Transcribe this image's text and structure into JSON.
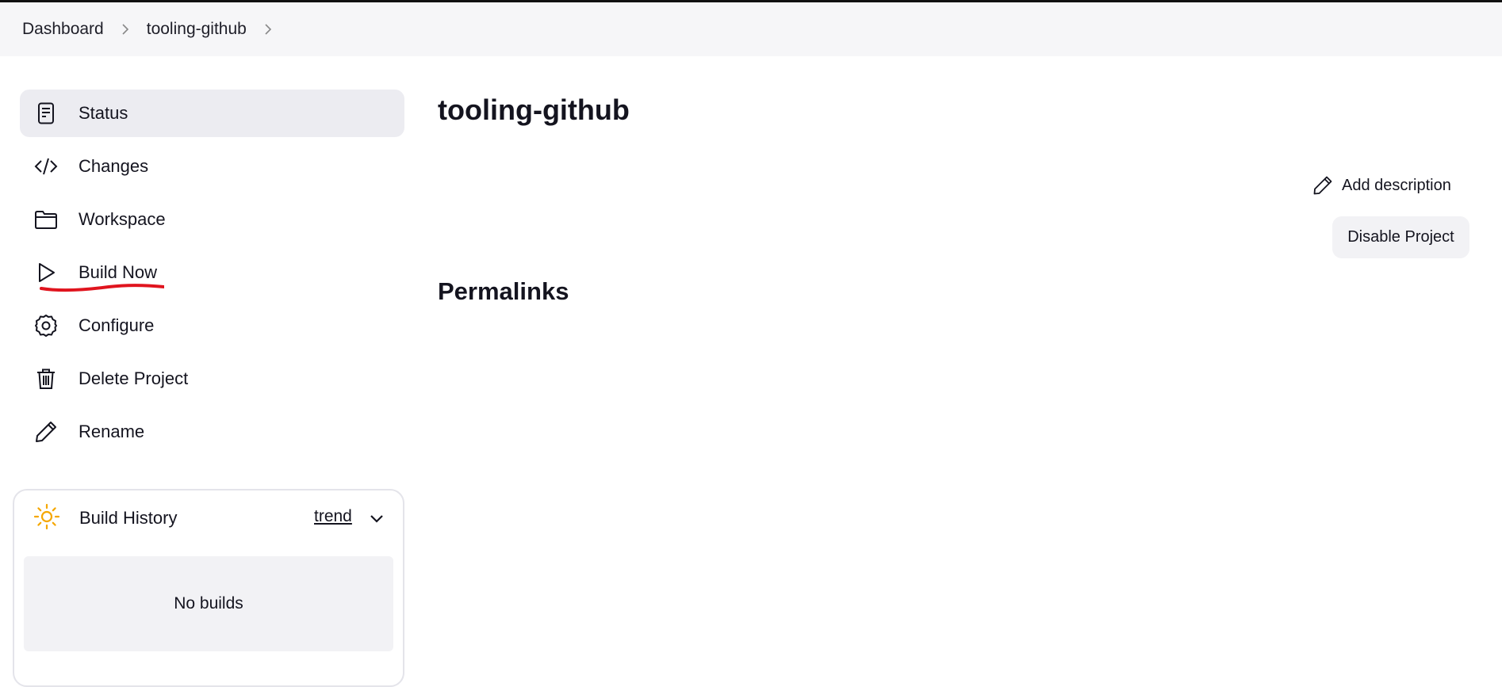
{
  "breadcrumb": {
    "items": [
      "Dashboard",
      "tooling-github"
    ],
    "separator_icon": "chevron-right-icon"
  },
  "sidebar": {
    "items": [
      {
        "label": "Status",
        "icon": "status-document-icon",
        "active": true
      },
      {
        "label": "Changes",
        "icon": "code-icon",
        "active": false
      },
      {
        "label": "Workspace",
        "icon": "folder-icon",
        "active": false
      },
      {
        "label": "Build Now",
        "icon": "play-icon",
        "active": false,
        "annotation": "red-underline"
      },
      {
        "label": "Configure",
        "icon": "gear-icon",
        "active": false
      },
      {
        "label": "Delete Project",
        "icon": "trash-icon",
        "active": false
      },
      {
        "label": "Rename",
        "icon": "pencil-icon",
        "active": false
      }
    ]
  },
  "build_history": {
    "title": "Build History",
    "trend_label": "trend",
    "empty_text": "No builds",
    "sun_icon_color": "#f5a700"
  },
  "main": {
    "title": "tooling-github",
    "add_description_label": "Add description",
    "disable_button_label": "Disable Project",
    "permalinks_heading": "Permalinks"
  },
  "colors": {
    "active_item_bg": "#ececf1",
    "breadcrumb_bg": "#f6f6f8",
    "annotation_red": "#e0141e"
  }
}
